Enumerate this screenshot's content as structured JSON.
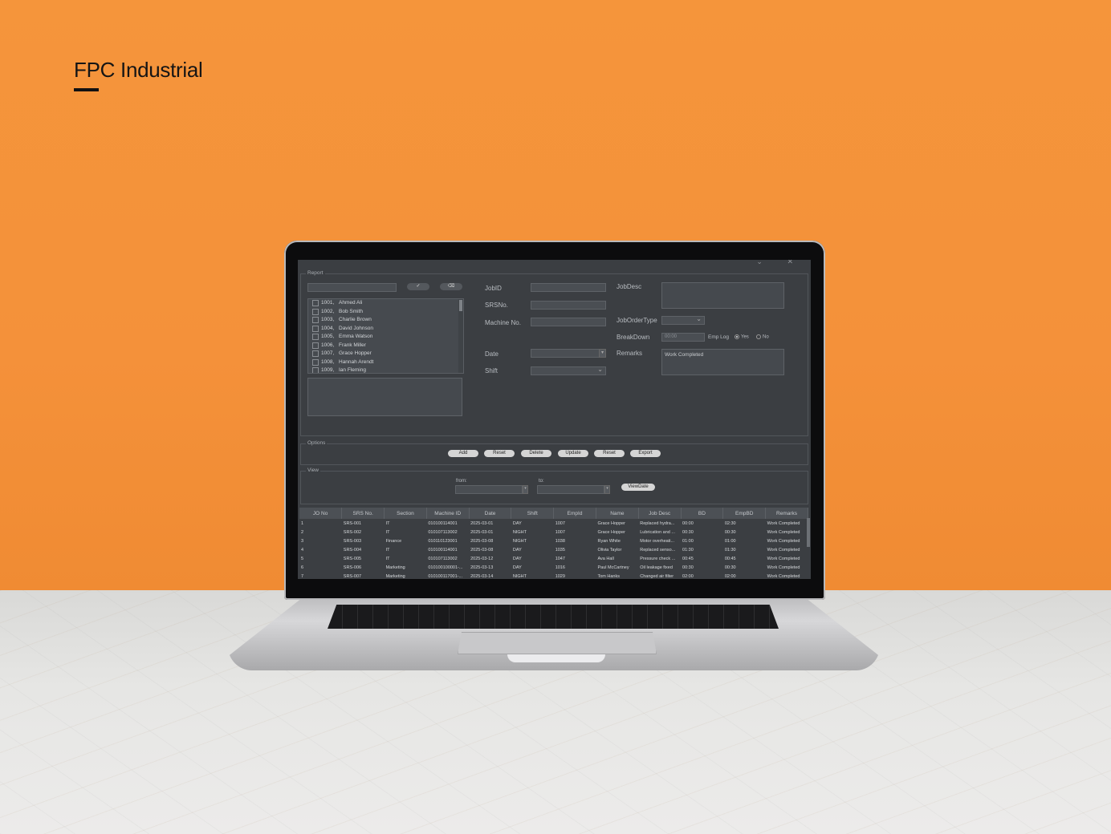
{
  "brand": {
    "name": "FPC Industrial"
  },
  "app": {
    "window_controls": "⌄ ✕",
    "report": {
      "legend": "Report",
      "search_value": "",
      "check_button": "✓",
      "clear_button": "⌫",
      "employees": [
        {
          "id": "1001,",
          "name": "Ahmed Ali"
        },
        {
          "id": "1002,",
          "name": "Bob Smith"
        },
        {
          "id": "1003,",
          "name": "Charlie Brown"
        },
        {
          "id": "1004,",
          "name": "David Johnson"
        },
        {
          "id": "1005,",
          "name": "Emma Watson"
        },
        {
          "id": "1006,",
          "name": "Frank Miller"
        },
        {
          "id": "1007,",
          "name": "Grace Hopper"
        },
        {
          "id": "1008,",
          "name": "Hannah Arendt"
        },
        {
          "id": "1009,",
          "name": "Ian Fleming"
        }
      ],
      "fields": {
        "jobid_label": "JobID",
        "srsno_label": "SRSNo.",
        "machineno_label": "Machine No.",
        "date_label": "Date",
        "shift_label": "Shift",
        "jobdesc_label": "JobDesc",
        "jobordertype_label": "JobOrderType",
        "breakdown_label": "BreakDown",
        "breakdown_value": "00:00",
        "emplog_label": "Emp Log",
        "yes_label": "Yes",
        "no_label": "No",
        "remarks_label": "Remarks",
        "remarks_value": "Work Completed"
      }
    },
    "options": {
      "legend": "Options",
      "buttons": [
        "Add",
        "Reset",
        "Delete",
        "Update",
        "Reset",
        "Export"
      ]
    },
    "view": {
      "legend": "View",
      "from_label": "from:",
      "to_label": "to:",
      "viewdate_button": "ViewDate"
    },
    "grid": {
      "columns": [
        "JO No",
        "SRS No.",
        "Section",
        "Machine ID",
        "Date",
        "Shift",
        "EmpId",
        "Name",
        "Job Desc",
        "BD",
        "EmpBD",
        "Remarks"
      ],
      "rows": [
        [
          "1",
          "SRS-001",
          "IT",
          "010100114001",
          "2025-03-01",
          "DAY",
          "1007",
          "Grace Hopper",
          "Replaced hydra...",
          "00:00",
          "02:30",
          "Work Completed"
        ],
        [
          "2",
          "SRS-002",
          "IT",
          "010107113002",
          "2025-03-01",
          "NIGHT",
          "1007",
          "Grace Hopper",
          "Lubrication and ...",
          "00:30",
          "00:30",
          "Work Completed"
        ],
        [
          "3",
          "SRS-003",
          "Finance",
          "010110123001",
          "2025-03-08",
          "NIGHT",
          "1038",
          "Ryan White",
          "Motor overheati...",
          "01:00",
          "01:00",
          "Work Completed"
        ],
        [
          "4",
          "SRS-004",
          "IT",
          "010100114001",
          "2025-03-08",
          "DAY",
          "1035",
          "Olivia Taylor",
          "Replaced senso...",
          "01:30",
          "01:30",
          "Work Completed"
        ],
        [
          "5",
          "SRS-005",
          "IT",
          "010107113002",
          "2025-03-12",
          "DAY",
          "1047",
          "Ava Hall",
          "Pressure check ...",
          "00:45",
          "00:45",
          "Work Completed"
        ],
        [
          "6",
          "SRS-006",
          "Marketing",
          "010100100001-...",
          "2025-03-13",
          "DAY",
          "1016",
          "Paul McCartney",
          "Oil leakage fixed",
          "00:30",
          "00:30",
          "Work Completed"
        ],
        [
          "7",
          "SRS-007",
          "Marketing",
          "010100117001-...",
          "2025-03-14",
          "NIGHT",
          "1029",
          "Tom Hanks",
          "Changed air filter",
          "02:00",
          "02:00",
          "Work Completed"
        ]
      ]
    }
  }
}
